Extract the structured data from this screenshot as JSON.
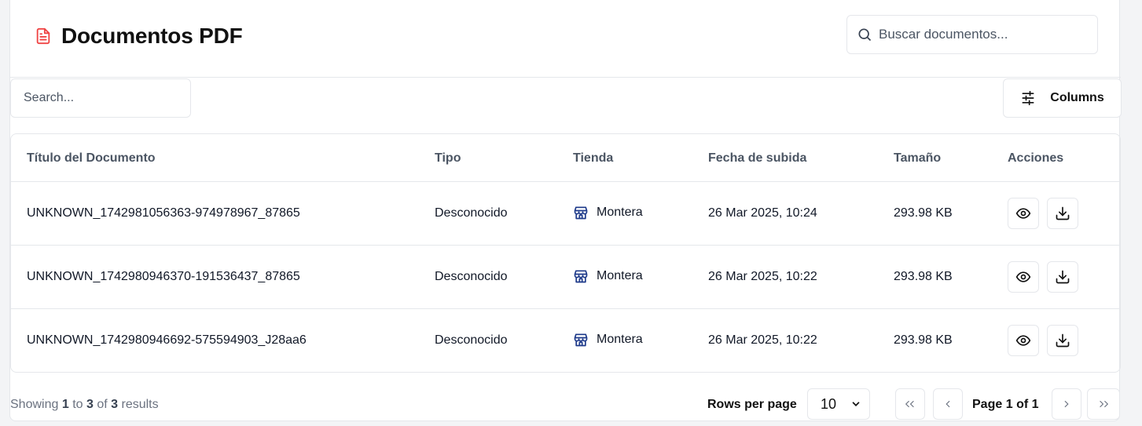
{
  "header": {
    "title": "Documentos PDF",
    "search_placeholder": "Buscar documentos..."
  },
  "toolbar": {
    "filter_placeholder": "Search...",
    "columns_label": "Columns"
  },
  "table": {
    "columns": [
      "Título del Documento",
      "Tipo",
      "Tienda",
      "Fecha de subida",
      "Tamaño",
      "Acciones"
    ],
    "rows": [
      {
        "title": "UNKNOWN_1742981056363-974978967_87865",
        "type": "Desconocido",
        "store": "Montera",
        "date": "26 Mar 2025, 10:24",
        "size": "293.98 KB"
      },
      {
        "title": "UNKNOWN_1742980946370-191536437_87865",
        "type": "Desconocido",
        "store": "Montera",
        "date": "26 Mar 2025, 10:22",
        "size": "293.98 KB"
      },
      {
        "title": "UNKNOWN_1742980946692-575594903_J28aa6",
        "type": "Desconocido",
        "store": "Montera",
        "date": "26 Mar 2025, 10:22",
        "size": "293.98 KB"
      }
    ]
  },
  "footer": {
    "showing_prefix": "Showing",
    "from": "1",
    "to_word": "to",
    "to": "3",
    "of_word": "of",
    "total": "3",
    "results_word": "results",
    "rows_per_page_label": "Rows per page",
    "rows_per_page_value": "10",
    "page_word": "Page",
    "page_current": "1",
    "page_of_word": "of",
    "page_total": "1"
  },
  "colors": {
    "pdf_icon": "#ef4444",
    "store_icon": "#1e3a8a",
    "border": "#e5e7eb"
  }
}
